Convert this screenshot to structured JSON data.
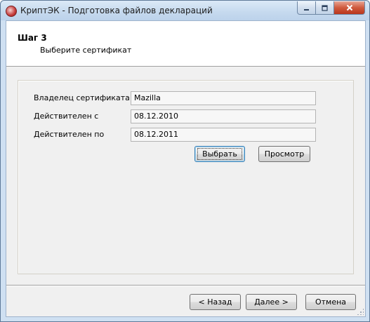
{
  "window": {
    "title": "КриптЭК - Подготовка файлов деклараций",
    "minimize_icon": "minimize-icon",
    "maximize_icon": "maximize-icon",
    "close_icon": "close-icon"
  },
  "header": {
    "step_title": "Шаг 3",
    "step_subtitle": "Выберите сертификат"
  },
  "certificate": {
    "owner_label": "Владелец сертификата",
    "owner_value": "Mazilla",
    "valid_from_label": "Действителен с",
    "valid_from_value": "08.12.2010",
    "valid_to_label": "Действителен по",
    "valid_to_value": "08.12.2011",
    "select_button": "Выбрать",
    "view_button": "Просмотр"
  },
  "footer": {
    "back_button": "< Назад",
    "next_button": "Далее >",
    "cancel_button": "Отмена"
  },
  "colors": {
    "frame": "#cfe0f2",
    "close_button": "#cf5a3e",
    "client_background": "#f0f0f0",
    "default_button_border": "#3c7fb1"
  }
}
